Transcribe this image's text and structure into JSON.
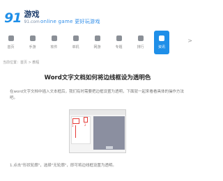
{
  "header": {
    "logo_number": "91",
    "logo_text": "游戏",
    "logo_sub": "91.com",
    "slogan": "online game 更好玩游戏"
  },
  "nav": {
    "items": [
      {
        "label": "首页"
      },
      {
        "label": "手游"
      },
      {
        "label": "软件"
      },
      {
        "label": "单机"
      },
      {
        "label": "网游"
      },
      {
        "label": "专题"
      },
      {
        "label": "排行"
      },
      {
        "label": "资讯"
      }
    ],
    "more": ">"
  },
  "breadcrumb": "当前位置：首页 > 教程",
  "article": {
    "title": "Word文字文档如何将边线框设为透明色",
    "intro": "在word文字文档中插入文本框后，我们有时需要把边框设置为透明，下面就一起来看看具体的操作方法吧。",
    "figure_labels": [
      "1",
      "2"
    ],
    "step": "1.点击\"形状轮廓\"，选择\"无轮廓\"，即可将边线框设置为透明。"
  }
}
